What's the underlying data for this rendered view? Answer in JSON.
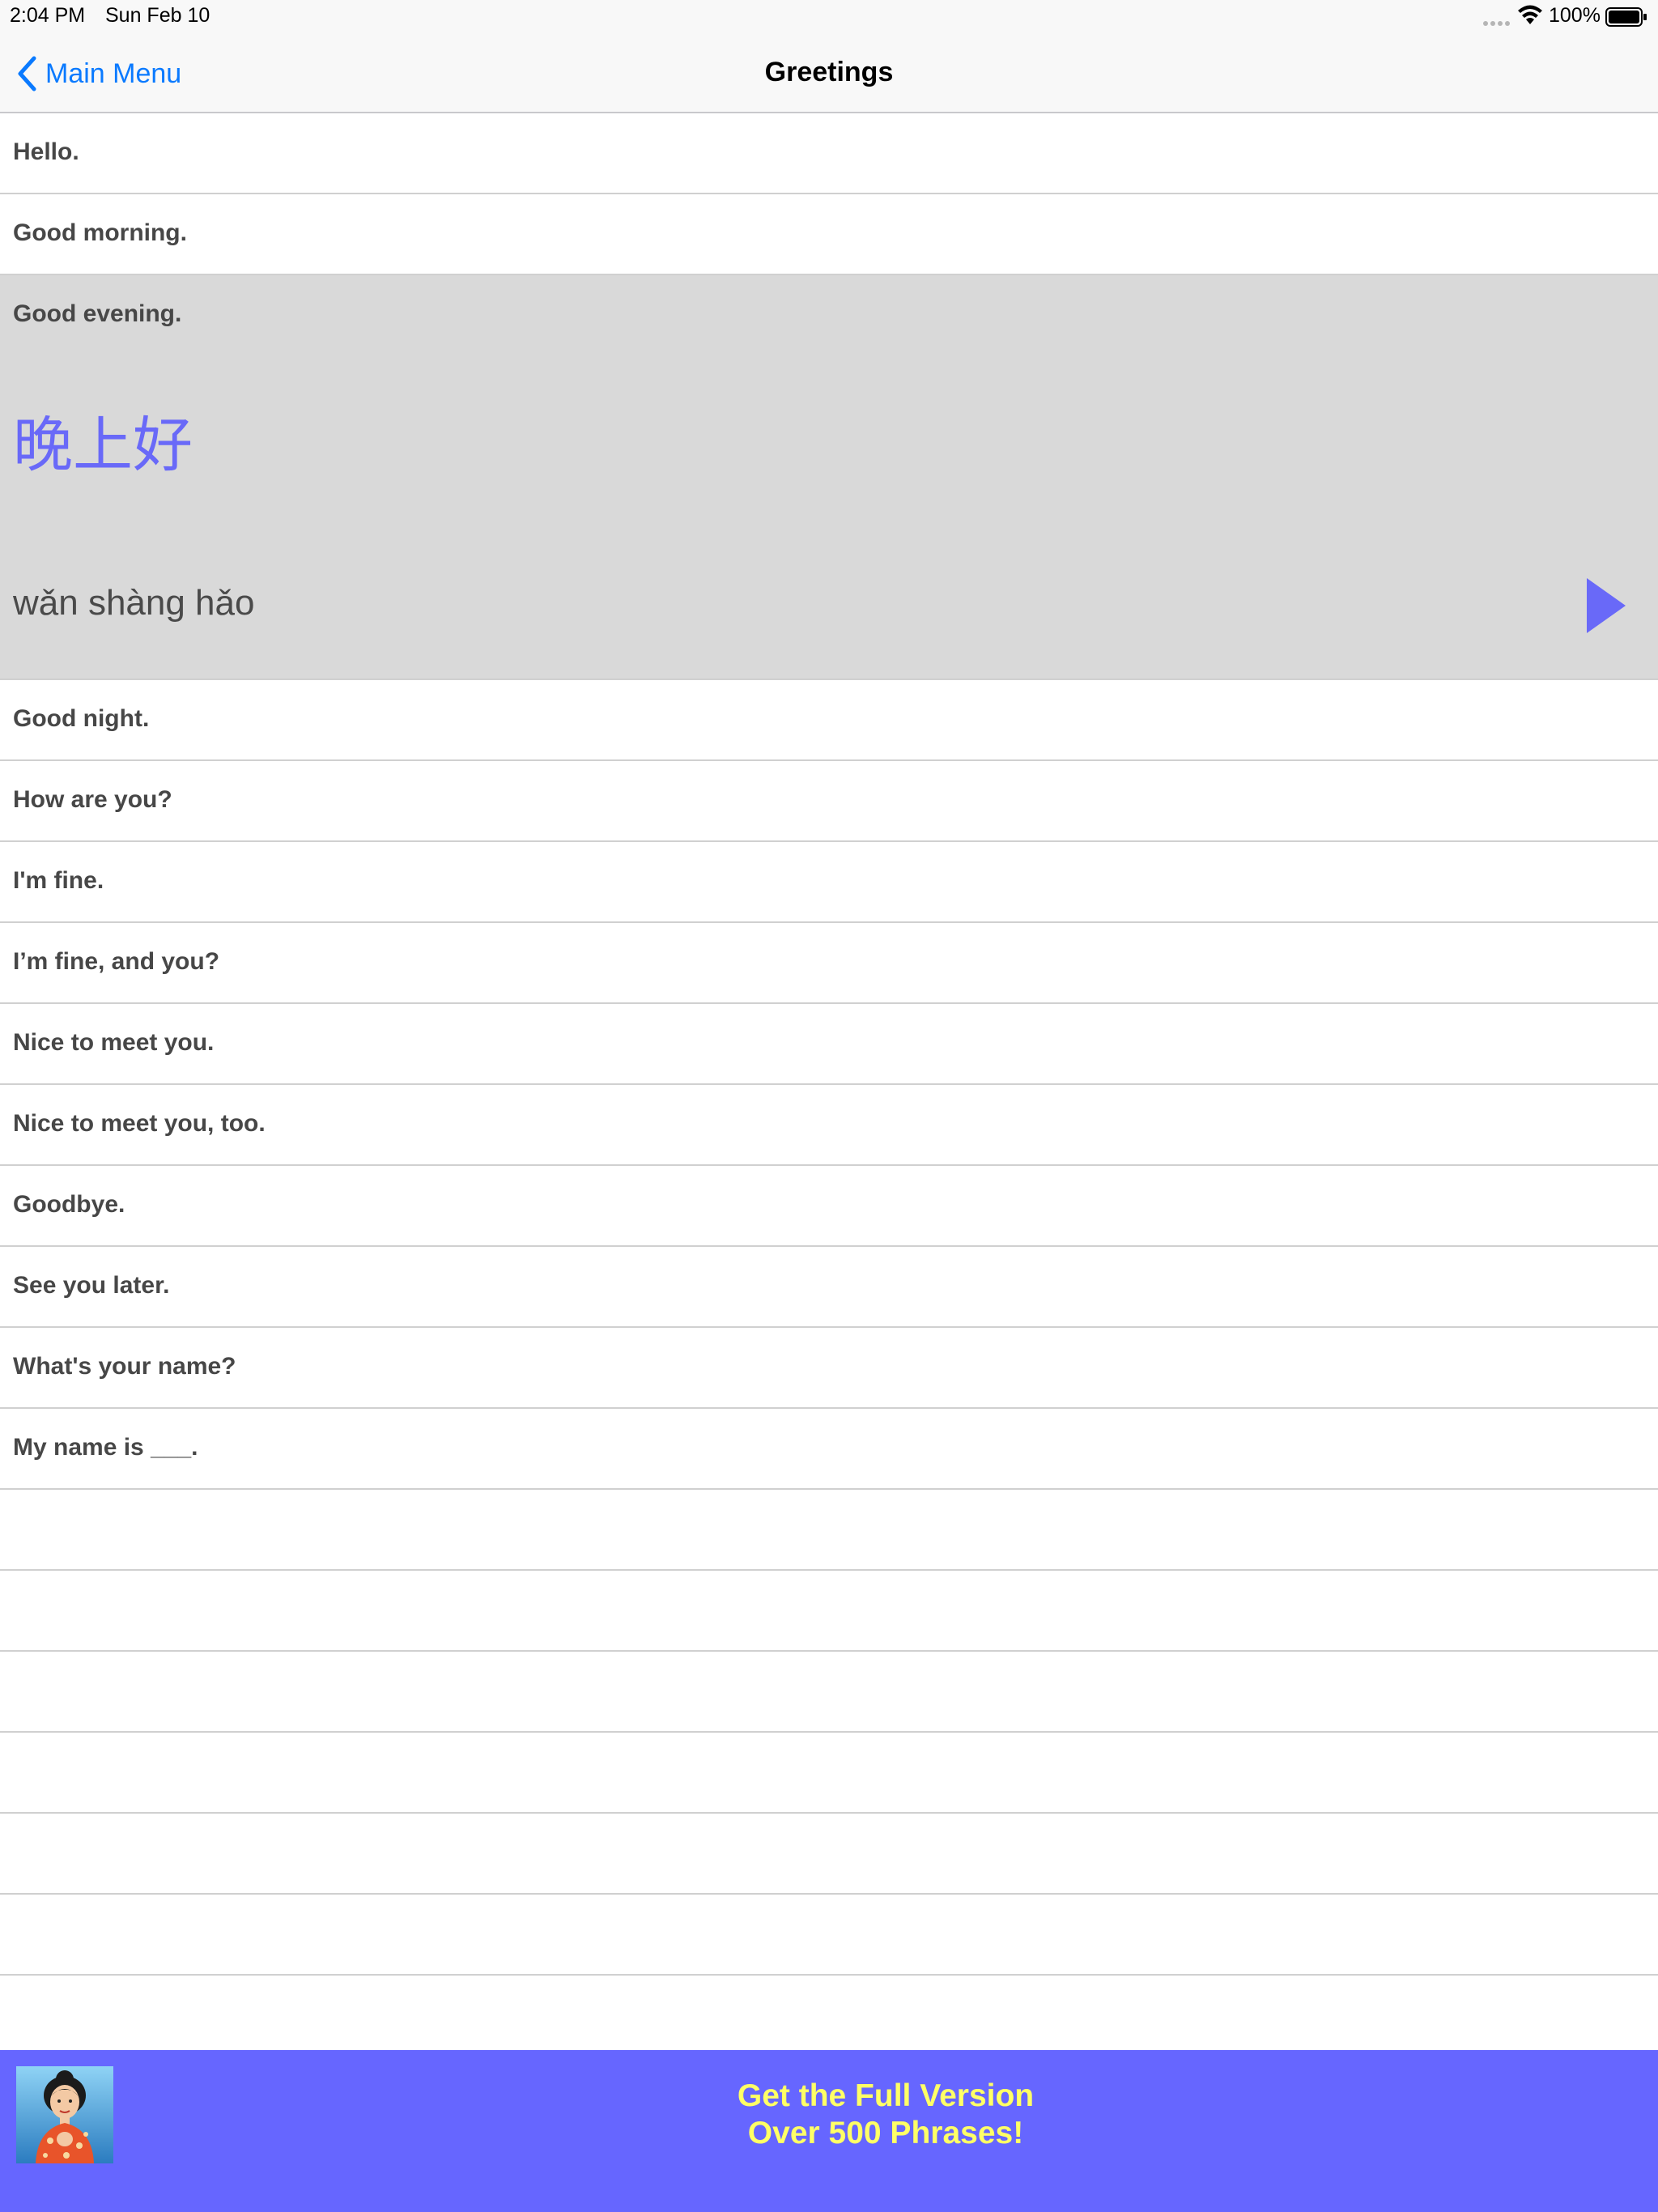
{
  "status_bar": {
    "time": "2:04 PM",
    "date": "Sun Feb 10",
    "battery": "100%"
  },
  "nav": {
    "back_label": "Main Menu",
    "title": "Greetings"
  },
  "phrases": [
    {
      "label": "Hello."
    },
    {
      "label": "Good morning."
    },
    {
      "label": "Good evening.",
      "hanzi": "晚上好",
      "pinyin": "wǎn shàng hǎo",
      "expanded": true
    },
    {
      "label": "Good night."
    },
    {
      "label": "How are you?"
    },
    {
      "label": "I'm fine."
    },
    {
      "label": "I’m fine, and you?"
    },
    {
      "label": "Nice to meet you."
    },
    {
      "label": "Nice to meet you, too."
    },
    {
      "label": "Goodbye."
    },
    {
      "label": "See you later."
    },
    {
      "label": "What's your name?"
    },
    {
      "label": "My name is ___."
    }
  ],
  "promo": {
    "line1": "Get the Full Version",
    "line2": "Over 500 Phrases!"
  },
  "colors": {
    "accent": "#0a7aff",
    "hanzi": "#6969f8",
    "selected_row": "#d9d9d9",
    "banner": "#6666ff",
    "banner_text": "#ffff66"
  }
}
